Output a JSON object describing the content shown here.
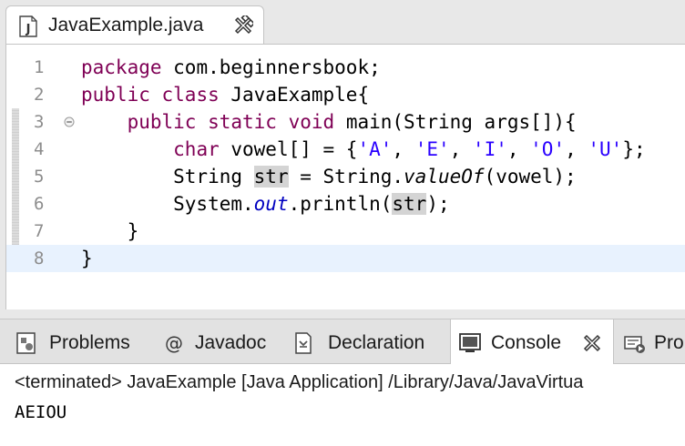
{
  "editor": {
    "tab": {
      "label": "JavaExample.java",
      "icon": "java-file-icon"
    },
    "lines": [
      {
        "num": "1",
        "tokens": [
          {
            "t": "package",
            "c": "kw"
          },
          {
            "t": " com.beginnersbook;"
          }
        ]
      },
      {
        "num": "2",
        "tokens": [
          {
            "t": "public",
            "c": "kw"
          },
          {
            "t": " "
          },
          {
            "t": "class",
            "c": "kw"
          },
          {
            "t": " JavaExample{"
          }
        ]
      },
      {
        "num": "3",
        "fold": true,
        "tokens": [
          {
            "t": "    "
          },
          {
            "t": "public",
            "c": "kw"
          },
          {
            "t": " "
          },
          {
            "t": "static",
            "c": "kw"
          },
          {
            "t": " "
          },
          {
            "t": "void",
            "c": "kw"
          },
          {
            "t": " main(String args[]){"
          }
        ]
      },
      {
        "num": "4",
        "tokens": [
          {
            "t": "        "
          },
          {
            "t": "char",
            "c": "kw"
          },
          {
            "t": " vowel[] = {"
          },
          {
            "t": "'A'",
            "c": "str"
          },
          {
            "t": ", "
          },
          {
            "t": "'E'",
            "c": "str"
          },
          {
            "t": ", "
          },
          {
            "t": "'I'",
            "c": "str"
          },
          {
            "t": ", "
          },
          {
            "t": "'O'",
            "c": "str"
          },
          {
            "t": ", "
          },
          {
            "t": "'U'",
            "c": "str"
          },
          {
            "t": "};"
          }
        ]
      },
      {
        "num": "5",
        "tokens": [
          {
            "t": "        String "
          },
          {
            "t": "str",
            "c": "occ"
          },
          {
            "t": " = String."
          },
          {
            "t": "valueOf",
            "c": "it"
          },
          {
            "t": "(vowel);"
          }
        ]
      },
      {
        "num": "6",
        "tokens": [
          {
            "t": "        System."
          },
          {
            "t": "out",
            "c": "fld it"
          },
          {
            "t": ".println("
          },
          {
            "t": "str",
            "c": "occ"
          },
          {
            "t": ");"
          }
        ]
      },
      {
        "num": "7",
        "tokens": [
          {
            "t": "    }"
          }
        ]
      },
      {
        "num": "8",
        "current": true,
        "tokens": [
          {
            "t": "}"
          }
        ]
      }
    ]
  },
  "panel": {
    "tabs": [
      {
        "label": "Problems",
        "icon": "problems-icon",
        "active": false
      },
      {
        "label": "Javadoc",
        "icon": "at-icon",
        "active": false
      },
      {
        "label": "Declaration",
        "icon": "declaration-icon",
        "active": false
      },
      {
        "label": "Console",
        "icon": "console-icon",
        "active": true
      },
      {
        "label": "Pro",
        "icon": "progress-icon",
        "active": false
      }
    ],
    "console": {
      "status": "<terminated> JavaExample [Java Application] /Library/Java/JavaVirtua",
      "output": "AEIOU"
    }
  },
  "colors": {
    "keyword": "#7f0055",
    "string": "#2a00ff",
    "field": "#0000c0",
    "occurrence_highlight": "#d4d4d4",
    "current_line": "#e8f2fe"
  }
}
